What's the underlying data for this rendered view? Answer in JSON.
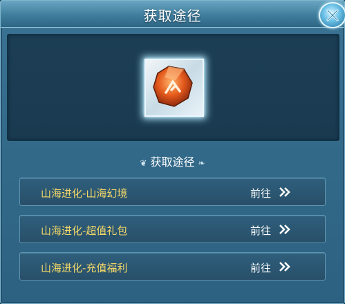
{
  "dialog": {
    "title": "获取途径",
    "section_label": "获取途径"
  },
  "routes": [
    {
      "name": "山海进化-山海幻境",
      "action": "前往"
    },
    {
      "name": "山海进化-超值礼包",
      "action": "前往"
    },
    {
      "name": "山海进化-充值福利",
      "action": "前往"
    }
  ],
  "colors": {
    "route_name": "#f5d867",
    "panel": "#336a8a",
    "display": "#1c3e55"
  },
  "icons": {
    "close": "close-icon",
    "item": "orange-crystal-icon",
    "go": "double-chevron-right-icon"
  }
}
